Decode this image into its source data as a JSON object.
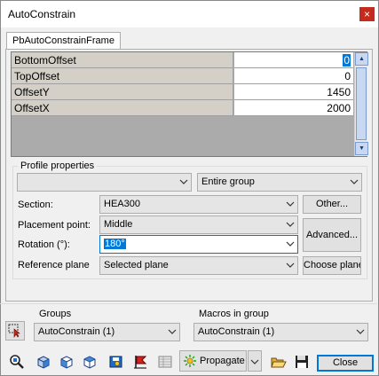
{
  "window": {
    "title": "AutoConstrain",
    "close_glyph": "×"
  },
  "tab": {
    "label": "PbAutoConstrainFrame"
  },
  "grid": {
    "rows": [
      {
        "name": "BottomOffset",
        "value": "0",
        "selected": true
      },
      {
        "name": "TopOffset",
        "value": "0",
        "selected": false
      },
      {
        "name": "OffsetY",
        "value": "1450",
        "selected": false
      },
      {
        "name": "OffsetX",
        "value": "2000",
        "selected": false
      }
    ]
  },
  "profile": {
    "group_label": "Profile properties",
    "top_left_combo": "",
    "top_right_combo": "Entire group",
    "section_label": "Section:",
    "section_value": "HEA300",
    "other_button": "Other...",
    "placement_label": "Placement point:",
    "placement_value": "Middle",
    "advanced_button": "Advanced...",
    "rotation_label": "Rotation (°):",
    "rotation_value": "180°",
    "refplane_label": "Reference plane",
    "refplane_value": "Selected plane",
    "choose_plane_button": "Choose plane"
  },
  "groups": {
    "label": "Groups",
    "value": "AutoConstrain (1)"
  },
  "macros": {
    "label": "Macros in group",
    "value": "AutoConstrain (1)"
  },
  "toolbar": {
    "propagate_label": "Propagate",
    "close_label": "Close",
    "icons": [
      "select-pointer-icon",
      "zoom-find-icon",
      "box-iso-icon",
      "box-front-icon",
      "box-right-icon",
      "save-to-model-icon",
      "flag-icon",
      "table-icon",
      "propagate-icon",
      "open-folder-icon",
      "floppy-save-icon"
    ]
  },
  "colors": {
    "selection": "#0078d7",
    "close_red": "#c42b1c",
    "accent_blue": "#1c6cc8"
  }
}
